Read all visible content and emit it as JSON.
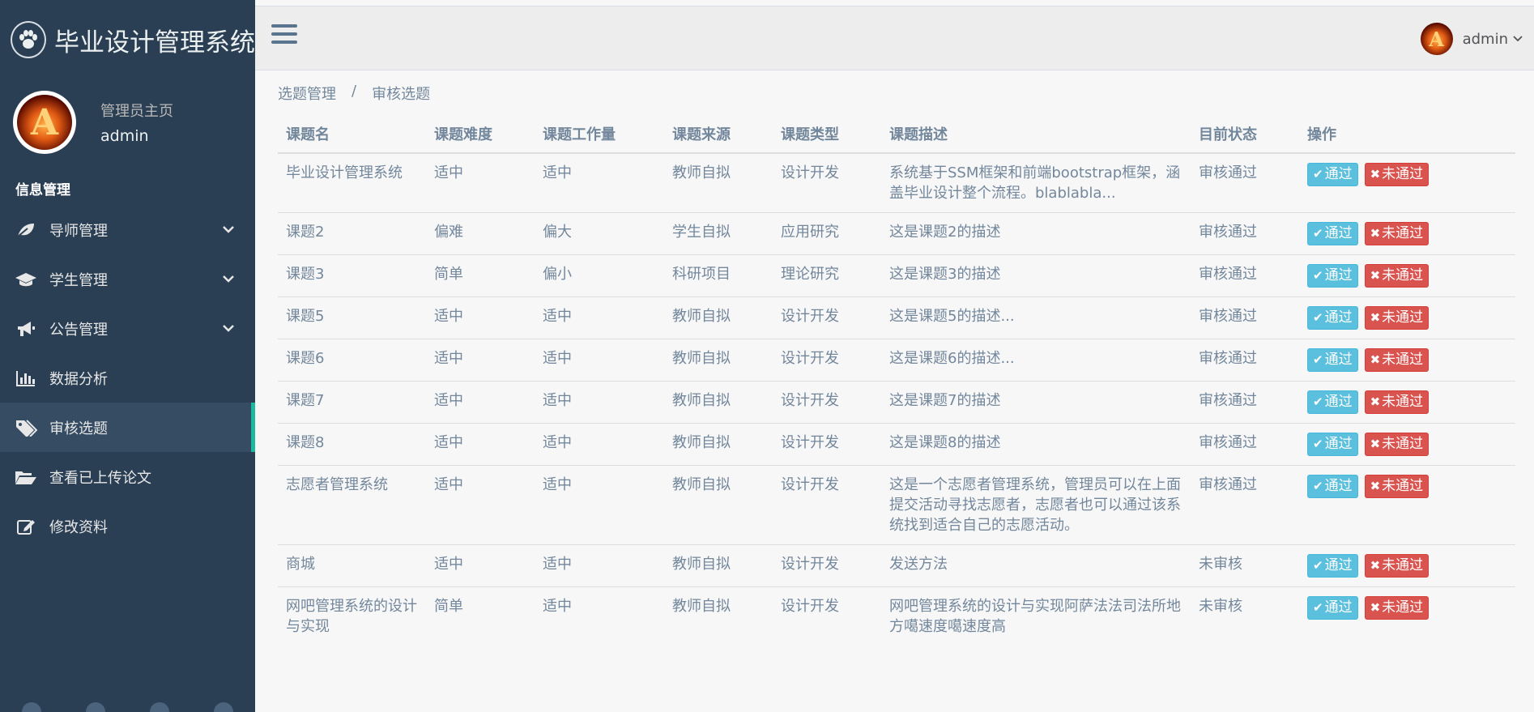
{
  "brand": {
    "title": "毕业设计管理系统"
  },
  "profile": {
    "welcome": "管理员主页",
    "name": "admin",
    "avatar_letter": "A"
  },
  "sidebar": {
    "section_title": "信息管理",
    "items": [
      {
        "label": "导师管理",
        "icon": "leaf-icon",
        "has_submenu": true
      },
      {
        "label": "学生管理",
        "icon": "graduation-cap-icon",
        "has_submenu": true
      },
      {
        "label": "公告管理",
        "icon": "bullhorn-icon",
        "has_submenu": true
      },
      {
        "label": "数据分析",
        "icon": "bar-chart-icon",
        "has_submenu": false
      },
      {
        "label": "审核选题",
        "icon": "tags-icon",
        "has_submenu": false,
        "active": true
      },
      {
        "label": "查看已上传论文",
        "icon": "folder-open-icon",
        "has_submenu": false
      },
      {
        "label": "修改资料",
        "icon": "edit-icon",
        "has_submenu": false
      }
    ]
  },
  "topnav": {
    "user_name": "admin",
    "avatar_letter": "A"
  },
  "breadcrumb": {
    "parent": "选题管理",
    "separator": "/",
    "current": "审核选题"
  },
  "table": {
    "headers": [
      "课题名",
      "课题难度",
      "课题工作量",
      "课题来源",
      "课题类型",
      "课题描述",
      "目前状态",
      "操作"
    ],
    "pass_label": "通过",
    "fail_label": "未通过",
    "rows": [
      {
        "name": "毕业设计管理系统",
        "difficulty": "适中",
        "workload": "适中",
        "source": "教师自拟",
        "type": "设计开发",
        "desc": "系统基于SSM框架和前端bootstrap框架，涵盖毕业设计整个流程。blablabla...",
        "status": "审核通过"
      },
      {
        "name": "课题2",
        "difficulty": "偏难",
        "workload": "偏大",
        "source": "学生自拟",
        "type": "应用研究",
        "desc": "这是课题2的描述",
        "status": "审核通过"
      },
      {
        "name": "课题3",
        "difficulty": "简单",
        "workload": "偏小",
        "source": "科研项目",
        "type": "理论研究",
        "desc": "这是课题3的描述",
        "status": "审核通过"
      },
      {
        "name": "课题5",
        "difficulty": "适中",
        "workload": "适中",
        "source": "教师自拟",
        "type": "设计开发",
        "desc": "这是课题5的描述...",
        "status": "审核通过"
      },
      {
        "name": "课题6",
        "difficulty": "适中",
        "workload": "适中",
        "source": "教师自拟",
        "type": "设计开发",
        "desc": "这是课题6的描述...",
        "status": "审核通过"
      },
      {
        "name": "课题7",
        "difficulty": "适中",
        "workload": "适中",
        "source": "教师自拟",
        "type": "设计开发",
        "desc": "这是课题7的描述",
        "status": "审核通过"
      },
      {
        "name": "课题8",
        "difficulty": "适中",
        "workload": "适中",
        "source": "教师自拟",
        "type": "设计开发",
        "desc": "这是课题8的描述",
        "status": "审核通过"
      },
      {
        "name": "志愿者管理系统",
        "difficulty": "适中",
        "workload": "适中",
        "source": "教师自拟",
        "type": "设计开发",
        "desc": "这是一个志愿者管理系统，管理员可以在上面提交活动寻找志愿者，志愿者也可以通过该系统找到适合自己的志愿活动。",
        "status": "审核通过"
      },
      {
        "name": "商城",
        "difficulty": "适中",
        "workload": "适中",
        "source": "教师自拟",
        "type": "设计开发",
        "desc": "发送方法",
        "status": "未审核"
      },
      {
        "name": "网吧管理系统的设计与实现",
        "difficulty": "简单",
        "workload": "适中",
        "source": "教师自拟",
        "type": "设计开发",
        "desc": "网吧管理系统的设计与实现阿萨法法司法所地方噶速度噶速度高",
        "status": "未审核"
      }
    ]
  },
  "colors": {
    "sidebar_bg": "#2a3f54",
    "active_indicator": "#1abb9c",
    "btn_pass": "#5bc0de",
    "btn_fail": "#d9534f"
  }
}
